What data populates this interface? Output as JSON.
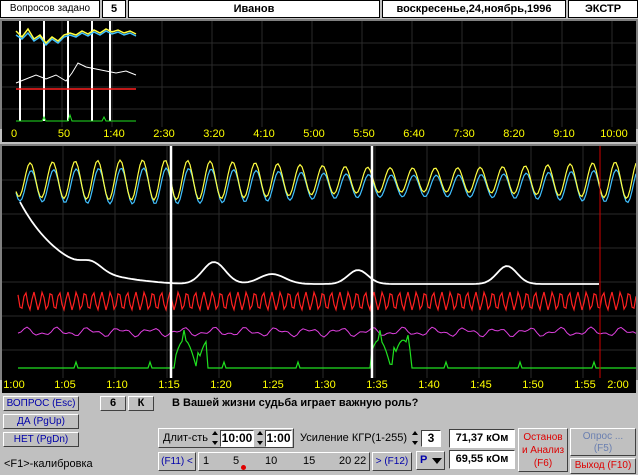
{
  "header": {
    "questions_label": "Вопросов задано",
    "questions_count": "5",
    "subject_name": "Иванов",
    "date": "воскресенье,24,ноябрь,1996",
    "mode": "ЭКСТР"
  },
  "overview": {
    "ticks": [
      "0",
      "50",
      "1:40",
      "2:30",
      "3:20",
      "4:10",
      "5:00",
      "5:50",
      "6:40",
      "7:30",
      "8:20",
      "9:10",
      "10:00"
    ]
  },
  "detail": {
    "ticks": [
      "1:00",
      "1:05",
      "1:10",
      "1:15",
      "1:20",
      "1:25",
      "1:30",
      "1:35",
      "1:40",
      "1:45",
      "1:50",
      "1:55",
      "2:00"
    ]
  },
  "controls": {
    "question_button": "ВОПРОС (Esc)",
    "yes_button": "ДА (PgUp)",
    "no_button": "НЕТ (PgDn)",
    "calibration": "<F1>-калибровка",
    "question_number": "6",
    "question_type": "К",
    "question_text": "В Вашей жизни судьба играет важную роль?",
    "duration_label": "Длит-сть",
    "duration_value": "10:00",
    "duration_value2": "1:00",
    "gain_label": "Усиление КГР(1-255)",
    "gain_value": "3",
    "resistance1": "71,37 кОм",
    "resistance2": "69,55 кОм",
    "stop_button_line1": "Останов",
    "stop_button_line2": "и Анализ",
    "stop_button_line3": "(F6)",
    "poll_button_line1": "Опрос ...",
    "poll_button_line2": "(F5)",
    "exit_button": "Выход (F10)",
    "nav_prev": "(F11) <",
    "nav_next": "> (F12)",
    "scale": [
      "1",
      "5",
      "10",
      "15",
      "20",
      "22"
    ],
    "channel": "Р"
  },
  "colors": {
    "trace_yellow": "#ffff40",
    "trace_cyan": "#40c0ff",
    "trace_white": "#ffffff",
    "trace_red": "#ff2020",
    "trace_magenta": "#e040e0",
    "trace_green": "#20e020"
  }
}
